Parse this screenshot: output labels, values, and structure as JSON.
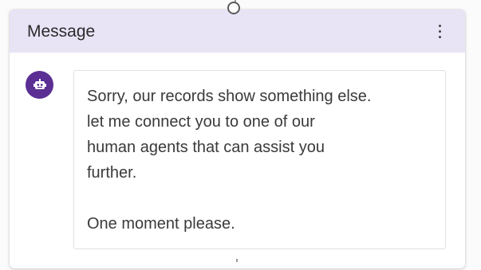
{
  "node": {
    "title": "Message",
    "more_icon": "more-vertical-icon",
    "avatar_icon": "bot-icon",
    "avatar_color": "#5b2e94",
    "header_color": "#e8e4f6",
    "message_text": "Sorry, our records show something else.\nlet me connect you to one of our\nhuman agents that can assist you\nfurther.\n\nOne moment please."
  }
}
